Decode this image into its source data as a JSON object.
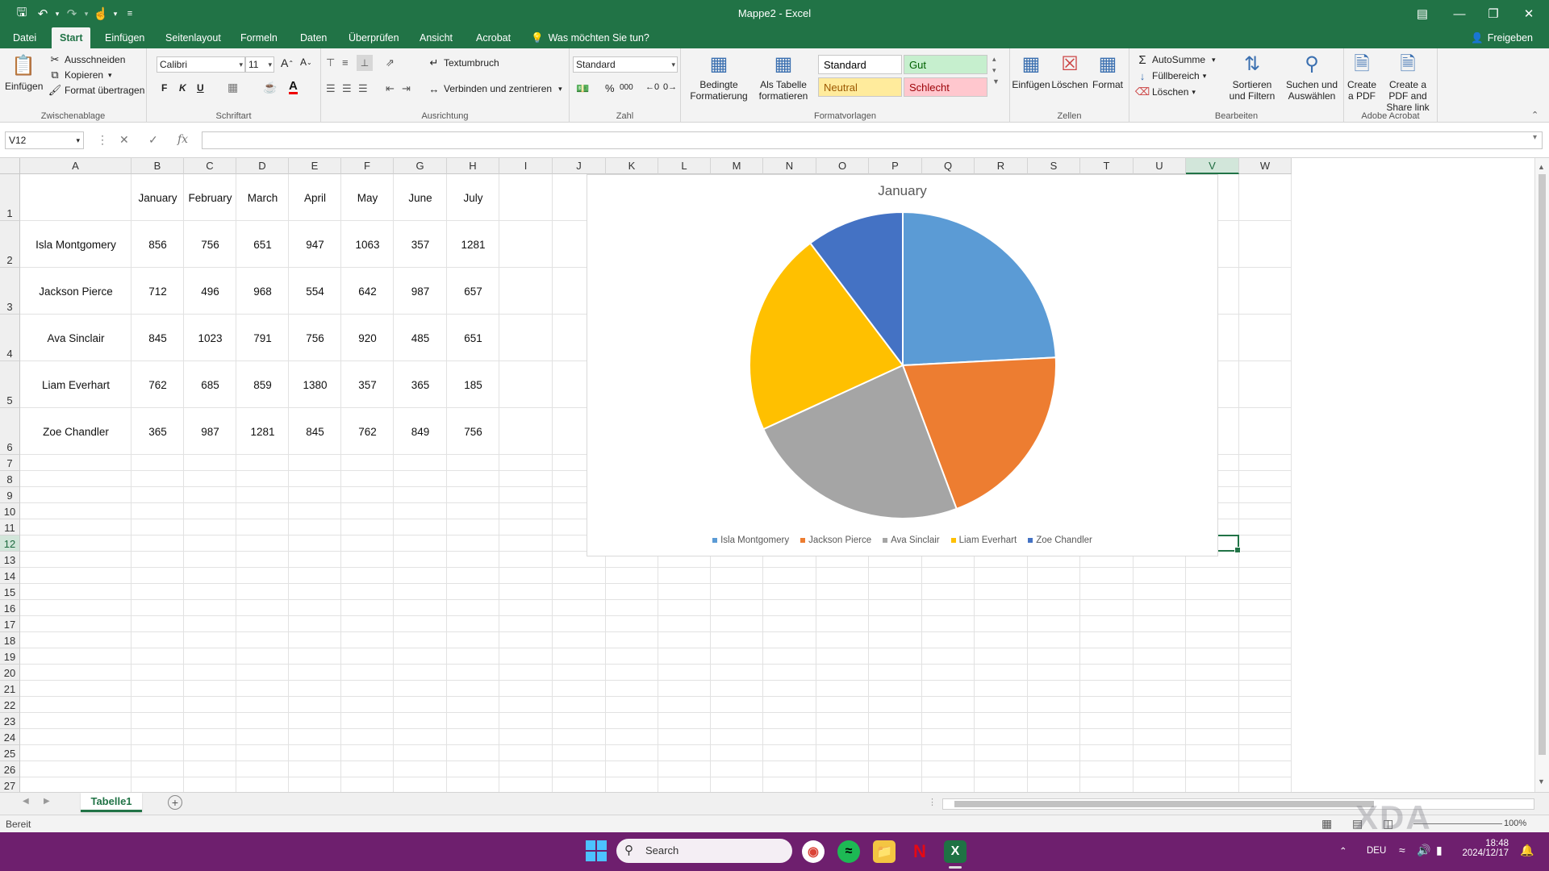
{
  "window": {
    "title": "Mappe2  -  Excel"
  },
  "tabs": [
    "Datei",
    "Start",
    "Einfügen",
    "Seitenlayout",
    "Formeln",
    "Daten",
    "Überprüfen",
    "Ansicht",
    "Acrobat"
  ],
  "active_tab": "Start",
  "tell_me": "Was möchten Sie tun?",
  "share": "Freigeben",
  "ribbon": {
    "clipboard": {
      "paste": "Einfügen",
      "cut": "Ausschneiden",
      "copy": "Kopieren",
      "format_painter": "Format übertragen",
      "label": "Zwischenablage"
    },
    "font": {
      "name": "Calibri",
      "size": "11",
      "bold": "F",
      "italic": "K",
      "underline": "U",
      "label": "Schriftart"
    },
    "alignment": {
      "wrap": "Textumbruch",
      "merge": "Verbinden und zentrieren",
      "label": "Ausrichtung"
    },
    "number": {
      "format": "Standard",
      "percent": "%",
      "thousands": "000",
      "label": "Zahl"
    },
    "styles": {
      "conditional": "Bedingte Formatierung",
      "as_table": "Als Tabelle formatieren",
      "cells": [
        {
          "name": "Standard",
          "bg": "#ffffff",
          "fg": "#000000"
        },
        {
          "name": "Gut",
          "bg": "#c6efce",
          "fg": "#006100"
        },
        {
          "name": "Neutral",
          "bg": "#ffeb9c",
          "fg": "#9c5700"
        },
        {
          "name": "Schlecht",
          "bg": "#ffc7ce",
          "fg": "#9c0006"
        }
      ],
      "label": "Formatvorlagen"
    },
    "cells": {
      "insert": "Einfügen",
      "delete": "Löschen",
      "format": "Format",
      "label": "Zellen"
    },
    "editing": {
      "autosum": "AutoSumme",
      "fill": "Füllbereich",
      "clear": "Löschen",
      "sort": "Sortieren und Filtern",
      "find": "Suchen und Auswählen",
      "label": "Bearbeiten"
    },
    "acrobat": {
      "create_pdf": "Create a PDF",
      "create_share": "Create a PDF and Share link",
      "label": "Adobe Acrobat"
    }
  },
  "formula_bar": {
    "name_box": "V12",
    "formula": ""
  },
  "columns": [
    "A",
    "B",
    "C",
    "D",
    "E",
    "F",
    "G",
    "H",
    "I",
    "J",
    "K",
    "L",
    "M",
    "N",
    "O",
    "P",
    "Q",
    "R",
    "S",
    "T",
    "U",
    "V",
    "W"
  ],
  "rows": [
    "1",
    "2",
    "3",
    "4",
    "5",
    "6",
    "7",
    "8",
    "9",
    "10",
    "11",
    "12",
    "13",
    "14",
    "15",
    "16",
    "17",
    "18",
    "19",
    "20",
    "21",
    "22",
    "23",
    "24",
    "25",
    "26",
    "27"
  ],
  "selected": {
    "col": "V",
    "row": "12"
  },
  "table": {
    "months": [
      "January",
      "February",
      "March",
      "April",
      "May",
      "June",
      "July"
    ],
    "rows": [
      {
        "name": "Isla Montgomery",
        "values": [
          "856",
          "756",
          "651",
          "947",
          "1063",
          "357",
          "1281"
        ]
      },
      {
        "name": "Jackson Pierce",
        "values": [
          "712",
          "496",
          "968",
          "554",
          "642",
          "987",
          "657"
        ]
      },
      {
        "name": "Ava Sinclair",
        "values": [
          "845",
          "1023",
          "791",
          "756",
          "920",
          "485",
          "651"
        ]
      },
      {
        "name": "Liam Everhart",
        "values": [
          "762",
          "685",
          "859",
          "1380",
          "357",
          "365",
          "185"
        ]
      },
      {
        "name": "Zoe Chandler",
        "values": [
          "365",
          "987",
          "1281",
          "845",
          "762",
          "849",
          "756"
        ]
      }
    ]
  },
  "chart_data": {
    "type": "pie",
    "title": "January",
    "categories": [
      "Isla Montgomery",
      "Jackson Pierce",
      "Ava Sinclair",
      "Liam Everhart",
      "Zoe Chandler"
    ],
    "values": [
      856,
      712,
      845,
      762,
      365
    ],
    "colors": [
      "#5b9bd5",
      "#ed7d31",
      "#a5a5a5",
      "#ffc000",
      "#4472c4"
    ],
    "legend_position": "bottom"
  },
  "sheet_tabs": [
    "Tabelle1"
  ],
  "status": {
    "ready": "Bereit",
    "zoom": "100%"
  },
  "taskbar": {
    "search": "Search",
    "lang": "DEU",
    "time": "18:48",
    "date": "2024/12/17"
  },
  "watermark": "XDA"
}
